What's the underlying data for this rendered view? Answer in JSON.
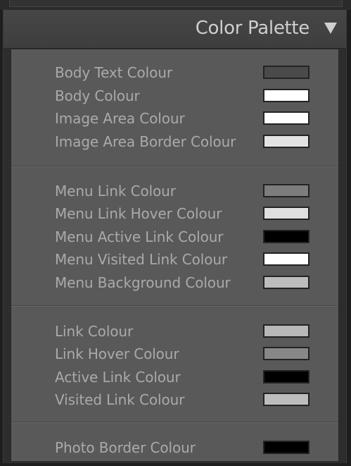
{
  "panel": {
    "title": "Color Palette",
    "collapse_icon": "triangle-down-icon"
  },
  "groups": [
    {
      "rows": [
        {
          "label": "Body Text Colour",
          "color": "#4a4a4a"
        },
        {
          "label": "Body Colour",
          "color": "#ffffff"
        },
        {
          "label": "Image Area Colour",
          "color": "#ffffff"
        },
        {
          "label": "Image Area Border Colour",
          "color": "#e3e3e3"
        }
      ]
    },
    {
      "rows": [
        {
          "label": "Menu Link Colour",
          "color": "#7d7d7d"
        },
        {
          "label": "Menu Link Hover Colour",
          "color": "#e0e0e0"
        },
        {
          "label": "Menu Active Link Colour",
          "color": "#000000"
        },
        {
          "label": "Menu Visited Link Colour",
          "color": "#ffffff"
        },
        {
          "label": "Menu Background Colour",
          "color": "#bdbdbd"
        }
      ]
    },
    {
      "rows": [
        {
          "label": "Link Colour",
          "color": "#b8b8b8"
        },
        {
          "label": "Link Hover Colour",
          "color": "#888888"
        },
        {
          "label": "Active Link Colour",
          "color": "#000000"
        },
        {
          "label": "Visited Link Colour",
          "color": "#bdbdbd"
        }
      ]
    },
    {
      "rows": [
        {
          "label": "Photo Border Colour",
          "color": "#000000"
        }
      ]
    }
  ]
}
